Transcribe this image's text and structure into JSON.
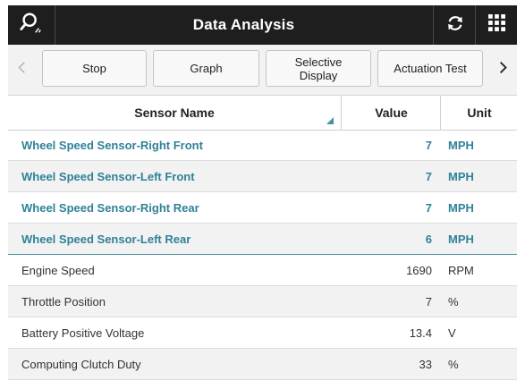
{
  "header": {
    "title": "Data Analysis",
    "left_icon": "search-pen-icon",
    "refresh_icon": "refresh-icon",
    "grid_icon": "grid-menu-icon"
  },
  "toolbar": {
    "prev_icon": "chevron-left-icon",
    "next_icon": "chevron-right-icon",
    "buttons": [
      {
        "line1": "Stop",
        "line2": ""
      },
      {
        "line1": "Graph",
        "line2": ""
      },
      {
        "line1": "Selective",
        "line2": "Display"
      },
      {
        "line1": "Actuation Test",
        "line2": ""
      }
    ]
  },
  "table": {
    "columns": [
      "Sensor Name",
      "Value",
      "Unit"
    ],
    "rows": [
      {
        "name": "Wheel Speed Sensor-Right Front",
        "value": "7",
        "unit": "MPH",
        "highlight": true
      },
      {
        "name": "Wheel Speed Sensor-Left Front",
        "value": "7",
        "unit": "MPH",
        "highlight": true
      },
      {
        "name": "Wheel Speed Sensor-Right Rear",
        "value": "7",
        "unit": "MPH",
        "highlight": true
      },
      {
        "name": "Wheel Speed Sensor-Left Rear",
        "value": "6",
        "unit": "MPH",
        "highlight": true
      },
      {
        "name": "Engine Speed",
        "value": "1690",
        "unit": "RPM",
        "highlight": false
      },
      {
        "name": "Throttle Position",
        "value": "7",
        "unit": "%",
        "highlight": false
      },
      {
        "name": "Battery Positive Voltage",
        "value": "13.4",
        "unit": "V",
        "highlight": false
      },
      {
        "name": "Computing Clutch Duty",
        "value": "33",
        "unit": "%",
        "highlight": false
      }
    ]
  },
  "colors": {
    "header_bg": "#1e1e1e",
    "highlight_text": "#2f8198",
    "accent": "#4a90a4"
  }
}
